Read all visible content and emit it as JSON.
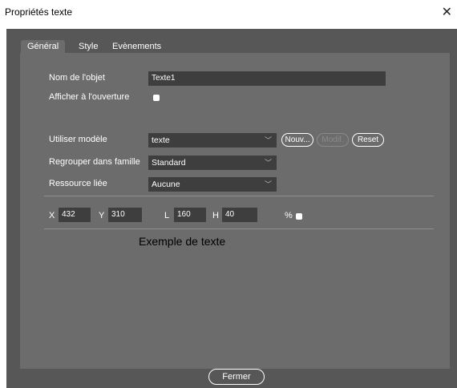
{
  "window": {
    "title": "Propriétés texte",
    "close_glyph": "✕"
  },
  "tabs": [
    "Général",
    "Style",
    "Evènements"
  ],
  "general": {
    "object_name_label": "Nom de l'objet",
    "object_name_value": "Texte1",
    "show_on_open_label": "Afficher à l'ouverture",
    "use_template_label": "Utiliser modèle",
    "template_value": "texte",
    "btn_new": "Nouv...",
    "btn_modify": "Modif.",
    "btn_reset": "Reset",
    "group_family_label": "Regrouper dans famille",
    "family_value": "Standard",
    "linked_resource_label": "Ressource liée",
    "resource_value": "Aucune",
    "x_label": "X",
    "x_value": "432",
    "y_label": "Y",
    "y_value": "310",
    "l_label": "L",
    "l_value": "160",
    "h_label": "H",
    "h_value": "40",
    "percent_label": "%",
    "sample_text": "Exemple de texte"
  },
  "footer": {
    "close_button": "Fermer"
  }
}
